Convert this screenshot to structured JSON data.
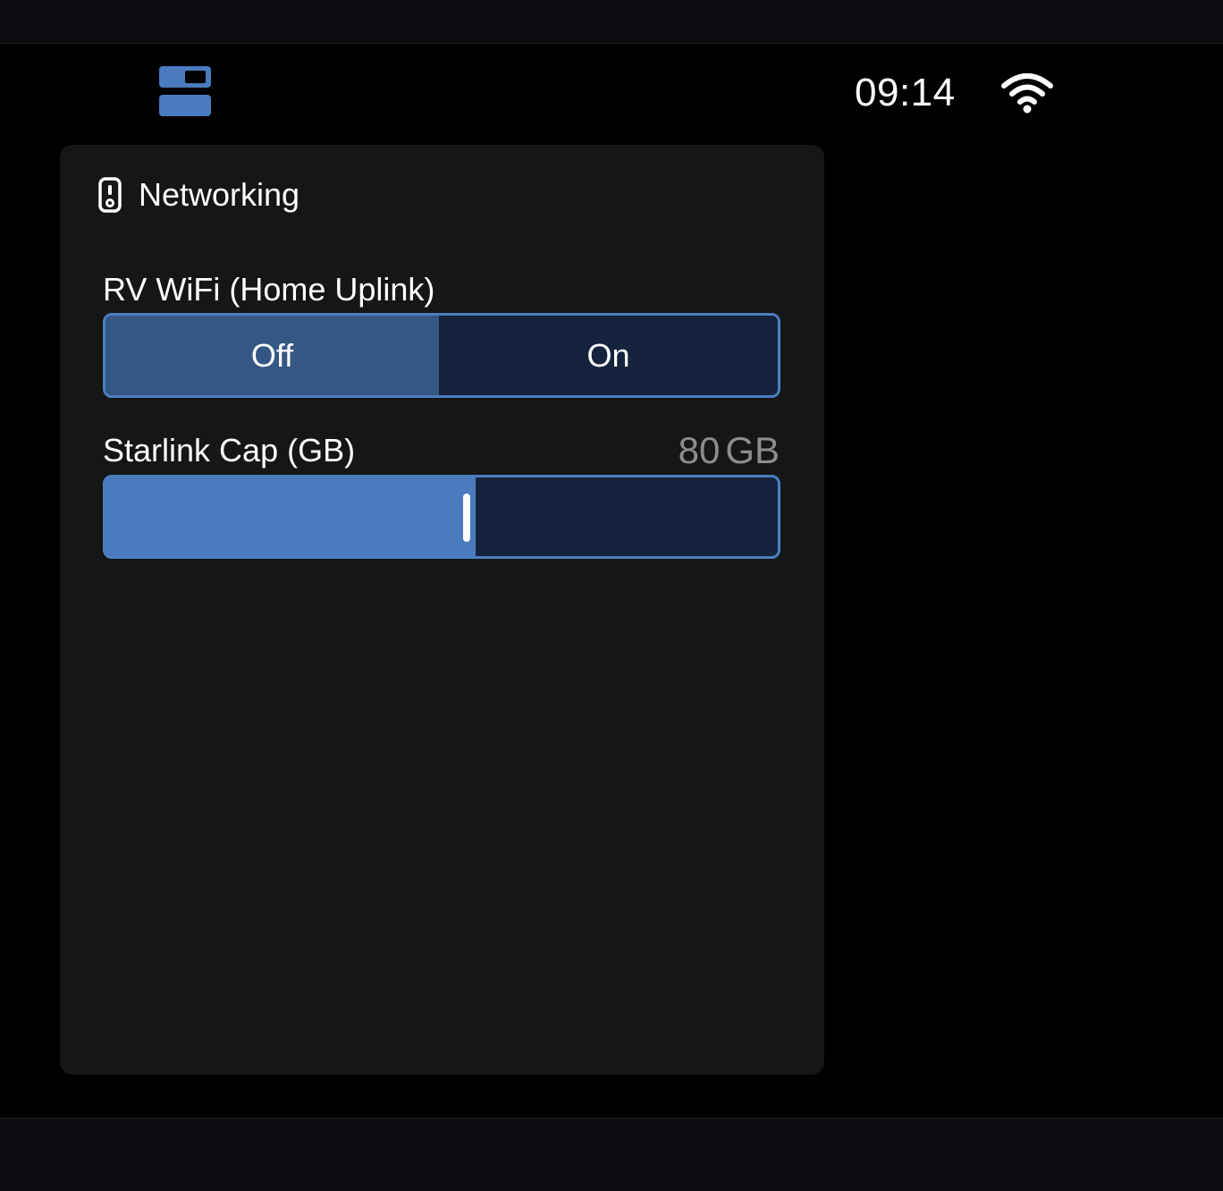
{
  "status_bar": {
    "panel_toggle_icon": "panel-toggle-icon",
    "time": "09:14",
    "wifi_icon": "wifi-signal-icon"
  },
  "card": {
    "icon": "remote-control-icon",
    "title": "Networking",
    "rv_wifi": {
      "label": "RV WiFi (Home Uplink)",
      "options": [
        "Off",
        "On"
      ],
      "selected": "Off"
    },
    "starlink_cap": {
      "label": "Starlink Cap (GB)",
      "value": "80",
      "unit": "GB",
      "fill_fraction": 0.55
    }
  },
  "colors": {
    "accent": "#4a7fc1",
    "segment_selected": "#345783",
    "segment_unselected": "#16233d",
    "card_background": "#161616",
    "value_text": "#8d8d8d"
  }
}
